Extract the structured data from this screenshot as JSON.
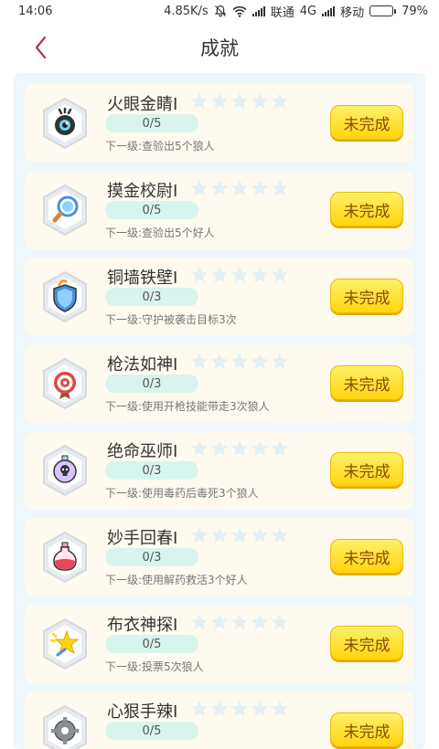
{
  "status_bar": {
    "time": "14:06",
    "network_speed": "4.85K/s",
    "carrier1": "联通",
    "network_type": "4G",
    "carrier2": "移动",
    "battery": "79%",
    "battery_level": 0.79
  },
  "header": {
    "title": "成就"
  },
  "achievements": [
    {
      "name": "火眼金睛I",
      "progress": "0/5",
      "next_level": "下一级:查验出5个狼人",
      "status": "未完成",
      "icon": "eye-icon",
      "stars_filled": 0
    },
    {
      "name": "摸金校尉I",
      "progress": "0/5",
      "next_level": "下一级:查验出5个好人",
      "status": "未完成",
      "icon": "magnifier-icon",
      "stars_filled": 0
    },
    {
      "name": "铜墙铁壁I",
      "progress": "0/3",
      "next_level": "下一级:守护被袭击目标3次",
      "status": "未完成",
      "icon": "shield-icon",
      "stars_filled": 0
    },
    {
      "name": "枪法如神I",
      "progress": "0/3",
      "next_level": "下一级:使用开枪技能带走3次狼人",
      "status": "未完成",
      "icon": "target-icon",
      "stars_filled": 0
    },
    {
      "name": "绝命巫师I",
      "progress": "0/3",
      "next_level": "下一级:使用毒药后毒死3个狼人",
      "status": "未完成",
      "icon": "poison-bottle-icon",
      "stars_filled": 0
    },
    {
      "name": "妙手回春I",
      "progress": "0/3",
      "next_level": "下一级:使用解药救活3个好人",
      "status": "未完成",
      "icon": "potion-bottle-icon",
      "stars_filled": 0
    },
    {
      "name": "布衣神探I",
      "progress": "0/5",
      "next_level": "下一级:投票5次狼人",
      "status": "未完成",
      "icon": "star-icon",
      "stars_filled": 0
    },
    {
      "name": "心狠手辣I",
      "progress": "0/5",
      "next_level": "",
      "status": "未完成",
      "icon": "gear-icon",
      "stars_filled": 0
    }
  ],
  "colors": {
    "panel_bg": "#eef7fb",
    "card_bg": "#fffaf0",
    "progress_bg": "#d8f4ee",
    "button_yellow": "#ffd60d",
    "star_empty": "#e2eff4",
    "back_arrow": "#b0345a"
  }
}
